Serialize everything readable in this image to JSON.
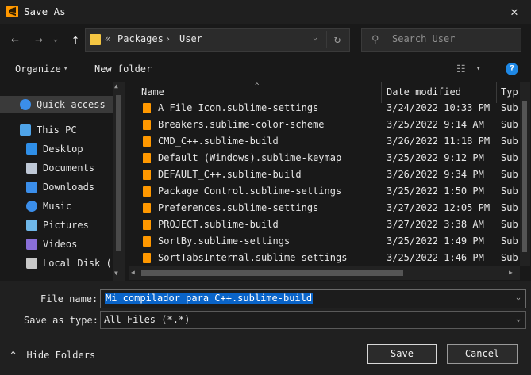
{
  "window": {
    "title": "Save As",
    "close_glyph": "✕"
  },
  "nav": {
    "back_glyph": "←",
    "forward_glyph": "→",
    "recent_glyph": "⌄",
    "up_glyph": "↑",
    "address": {
      "chevron": "«",
      "segments": [
        "Packages",
        "User"
      ],
      "separator": "›",
      "dropdown_glyph": "⌄",
      "refresh_glyph": "↻"
    },
    "search": {
      "placeholder": "Search User",
      "icon_glyph": "⚲"
    }
  },
  "toolbar": {
    "organize_label": "Organize",
    "new_folder_label": "New folder",
    "chevron": "▾",
    "view_glyph": "☷",
    "help_glyph": "?"
  },
  "sidebar": {
    "items": [
      {
        "label": "Quick access",
        "icon": "star-icon",
        "indent": 1,
        "color": "#3b8eea"
      },
      {
        "label": "This PC",
        "icon": "computer-icon",
        "indent": 1,
        "color": "#4ea3e8"
      },
      {
        "label": "Desktop",
        "icon": "desktop-icon",
        "indent": 2,
        "color": "#2f8fe8"
      },
      {
        "label": "Documents",
        "icon": "documents-icon",
        "indent": 2,
        "color": "#bfc8d6"
      },
      {
        "label": "Downloads",
        "icon": "downloads-icon",
        "indent": 2,
        "color": "#3b8eea"
      },
      {
        "label": "Music",
        "icon": "music-icon",
        "indent": 2,
        "color": "#3b8eea"
      },
      {
        "label": "Pictures",
        "icon": "pictures-icon",
        "indent": 2,
        "color": "#6fb7e8"
      },
      {
        "label": "Videos",
        "icon": "videos-icon",
        "indent": 2,
        "color": "#8a6fd8"
      },
      {
        "label": "Local Disk (",
        "icon": "disk-icon",
        "indent": 2,
        "color": "#c9c9c9"
      }
    ]
  },
  "files": {
    "columns": [
      "Name",
      "Date modified",
      "Typ"
    ],
    "sort_glyph": "^",
    "rows": [
      {
        "name": "A File Icon.sublime-settings",
        "date": "3/24/2022 10:33 PM",
        "type": "Sub"
      },
      {
        "name": "Breakers.sublime-color-scheme",
        "date": "3/25/2022 9:14 AM",
        "type": "Sub"
      },
      {
        "name": "CMD_C++.sublime-build",
        "date": "3/26/2022 11:18 PM",
        "type": "Sub"
      },
      {
        "name": "Default (Windows).sublime-keymap",
        "date": "3/25/2022 9:12 PM",
        "type": "Sub"
      },
      {
        "name": "DEFAULT_C++.sublime-build",
        "date": "3/26/2022 9:34 PM",
        "type": "Sub"
      },
      {
        "name": "Package Control.sublime-settings",
        "date": "3/25/2022 1:50 PM",
        "type": "Sub"
      },
      {
        "name": "Preferences.sublime-settings",
        "date": "3/27/2022 12:05 PM",
        "type": "Sub"
      },
      {
        "name": "PROJECT.sublime-build",
        "date": "3/27/2022 3:38 AM",
        "type": "Sub"
      },
      {
        "name": "SortBy.sublime-settings",
        "date": "3/25/2022 1:49 PM",
        "type": "Sub"
      },
      {
        "name": "SortTabsInternal.sublime-settings",
        "date": "3/25/2022 1:46 PM",
        "type": "Sub"
      }
    ]
  },
  "form": {
    "file_name_label": "File name:",
    "file_name_value": "Mi compilador para C++.sublime-build",
    "save_type_label": "Save as type:",
    "save_type_value": "All Files (*.*)",
    "dropdown_glyph": "⌄"
  },
  "footer": {
    "hide_folders_label": "Hide Folders",
    "hide_glyph": "^",
    "save_label": "Save",
    "cancel_label": "Cancel"
  },
  "colors": {
    "accent": "#0a64c8",
    "sublime_orange": "#ff9800",
    "folder_yellow": "#f4c542",
    "help_blue": "#1e88e5"
  }
}
